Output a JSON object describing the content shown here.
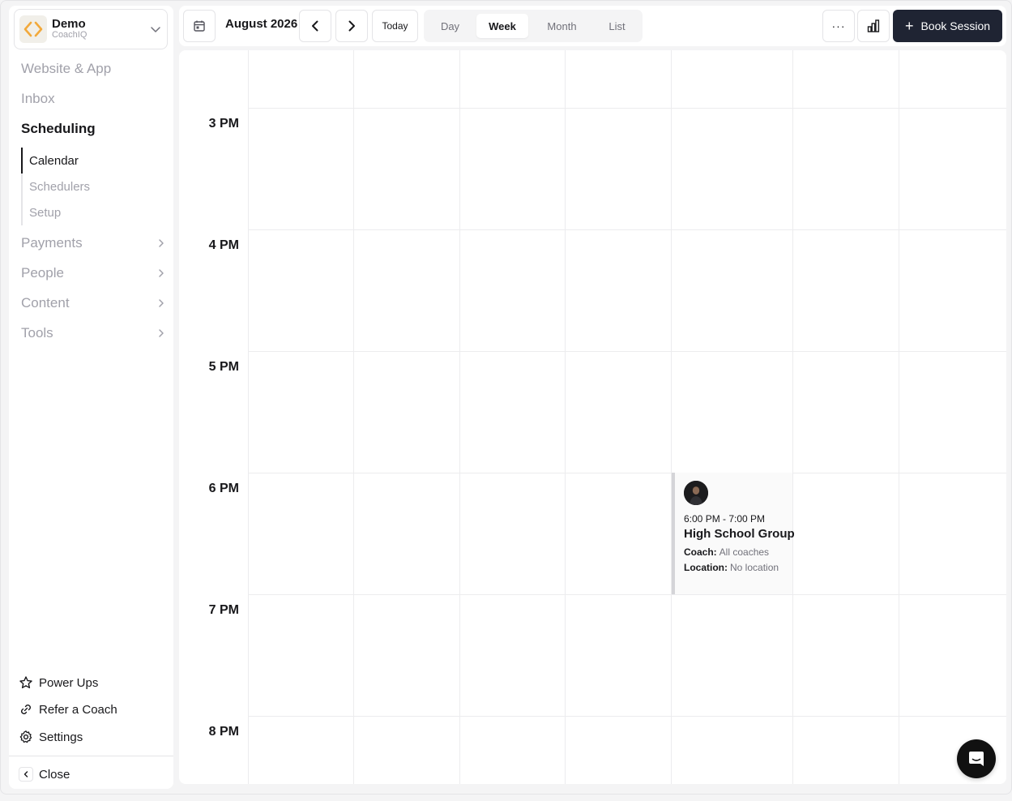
{
  "org": {
    "name": "Demo",
    "subtitle": "CoachIQ"
  },
  "sidebar": {
    "items": [
      {
        "label": "Website & App"
      },
      {
        "label": "Inbox"
      },
      {
        "label": "Scheduling"
      },
      {
        "label": "Payments"
      },
      {
        "label": "People"
      },
      {
        "label": "Content"
      },
      {
        "label": "Tools"
      }
    ],
    "scheduling_sub": [
      {
        "label": "Calendar"
      },
      {
        "label": "Schedulers"
      },
      {
        "label": "Setup"
      }
    ],
    "bottom": [
      {
        "label": "Power Ups",
        "icon": "star-icon"
      },
      {
        "label": "Refer a Coach",
        "icon": "link-icon"
      },
      {
        "label": "Settings",
        "icon": "gear-icon"
      }
    ],
    "close_label": "Close"
  },
  "toolbar": {
    "month_label": "August 2026",
    "today_label": "Today",
    "views": [
      "Day",
      "Week",
      "Month",
      "List"
    ],
    "active_view": "Week",
    "more_label": "···",
    "book_label": "Book Session"
  },
  "calendar": {
    "hours": [
      "3 PM",
      "4 PM",
      "5 PM",
      "6 PM",
      "7 PM",
      "8 PM"
    ],
    "event": {
      "time": "6:00 PM - 7:00 PM",
      "title": "High School Group",
      "coach_label": "Coach:",
      "coach_value": "All coaches",
      "location_label": "Location:",
      "location_value": "No location"
    }
  },
  "colors": {
    "accent_dark": "#1f2433",
    "logo_gold": "#f2a93b",
    "grid": "#ececee"
  }
}
